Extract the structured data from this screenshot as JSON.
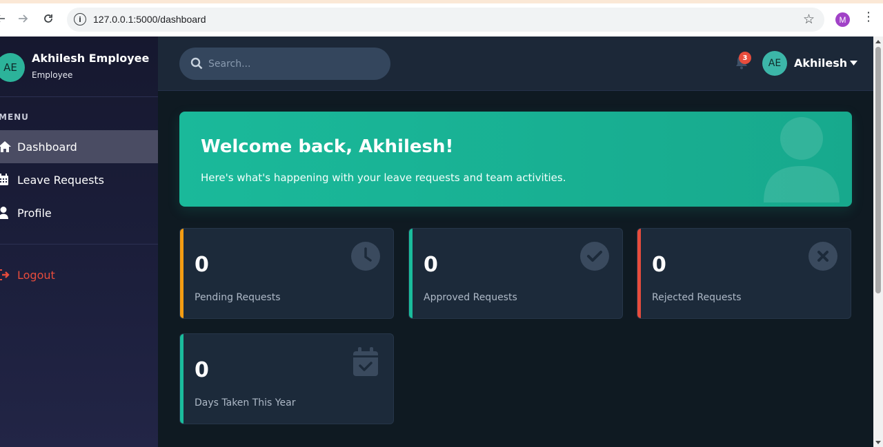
{
  "browser": {
    "url": "127.0.0.1:5000/dashboard",
    "profile_initial": "M"
  },
  "sidebar": {
    "avatar_initials": "AE",
    "user_name": "Akhilesh Employee",
    "user_role": "Employee",
    "menu_label": "MENU",
    "items": [
      {
        "label": "Dashboard",
        "icon": "home-icon",
        "active": true
      },
      {
        "label": "Leave Requests",
        "icon": "calendar-icon",
        "active": false
      },
      {
        "label": "Profile",
        "icon": "user-icon",
        "active": false
      }
    ],
    "logout_label": "Logout"
  },
  "topbar": {
    "search_placeholder": "Search...",
    "notification_count": "3",
    "avatar_initials": "AE",
    "user_name": "Akhilesh"
  },
  "hero": {
    "title": "Welcome back, Akhilesh!",
    "subtitle": "Here's what's happening with your leave requests and team activities."
  },
  "stats": [
    {
      "value": "0",
      "label": "Pending Requests",
      "accent": "#f39c12",
      "icon": "clock-icon"
    },
    {
      "value": "0",
      "label": "Approved Requests",
      "accent": "#1abc9c",
      "icon": "check-circle-icon"
    },
    {
      "value": "0",
      "label": "Rejected Requests",
      "accent": "#e74c3c",
      "icon": "x-circle-icon"
    },
    {
      "value": "0",
      "label": "Days Taken This Year",
      "accent": "#1abc9c",
      "icon": "calendar-check-icon"
    }
  ],
  "colors": {
    "brand_teal": "#1ab99a",
    "danger": "#e74c3c",
    "warning": "#f39c12"
  }
}
